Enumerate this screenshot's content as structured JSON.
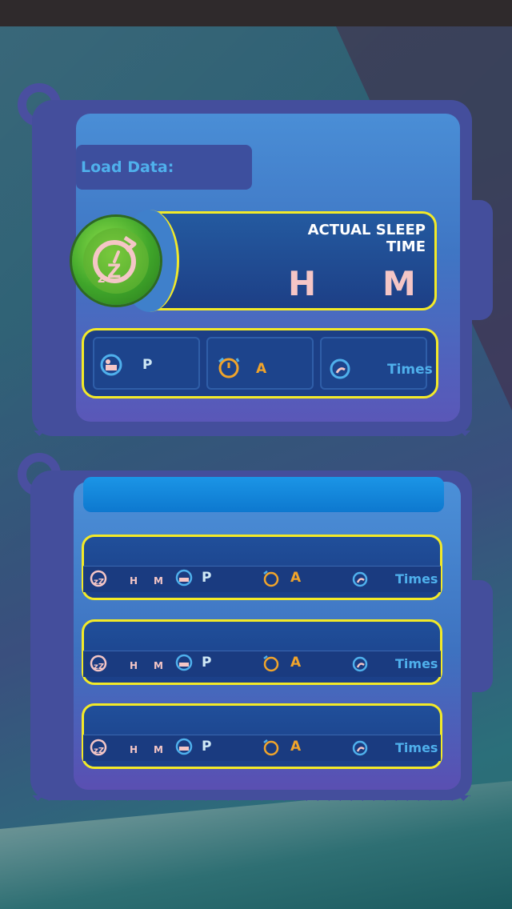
{
  "load": {
    "label": "Load Data:"
  },
  "sleep": {
    "title": "ACTUAL SLEEP TIME",
    "hours_unit": "H",
    "minutes_unit": "M"
  },
  "stats": [
    {
      "icon": "bed-person-icon",
      "label": "P"
    },
    {
      "icon": "alarm-clock-icon",
      "label": "A"
    },
    {
      "icon": "snore-icon",
      "label": "Times"
    }
  ],
  "records": [
    {
      "h": "H",
      "m": "M",
      "p": "P",
      "a": "A",
      "times": "Times"
    },
    {
      "h": "H",
      "m": "M",
      "p": "P",
      "a": "A",
      "times": "Times"
    },
    {
      "h": "H",
      "m": "M",
      "p": "P",
      "a": "A",
      "times": "Times"
    }
  ],
  "colors": {
    "accent_yellow": "#f3ea28",
    "light_blue_text": "#4fb0ec",
    "orange_text": "#f0a42b",
    "pink_text": "#f5c6c6",
    "green_badge": "#4aa42a"
  }
}
